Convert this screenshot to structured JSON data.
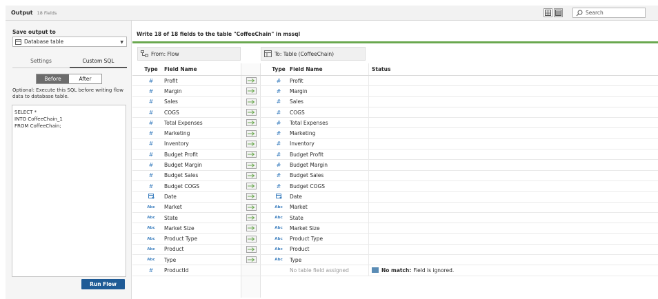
{
  "header": {
    "title": "Output",
    "field_count": "18 Fields",
    "search_placeholder": "Search"
  },
  "left": {
    "save_label": "Save output to",
    "save_target": "Database table",
    "tabs": [
      "Settings",
      "Custom SQL"
    ],
    "segments": [
      "Before",
      "After"
    ],
    "hint": "Optional: Execute this SQL before writing flow data to database table.",
    "sql_lines": [
      "SELECT *",
      "INTO CoffeeChain_1",
      "FROM CoffeeChain;"
    ],
    "run_label": "Run Flow"
  },
  "main": {
    "write_title": "Write 18 of 18 fields to the table \"CoffeeChain\" in mssql",
    "from_label": "From: Flow",
    "to_label": "To: Table (CoffeeChain)",
    "columns": {
      "type": "Type",
      "field_name": "Field Name",
      "status": "Status"
    },
    "rows": [
      {
        "type": "num",
        "from": "Profit",
        "to": "Profit"
      },
      {
        "type": "num",
        "from": "Margin",
        "to": "Margin"
      },
      {
        "type": "num",
        "from": "Sales",
        "to": "Sales"
      },
      {
        "type": "num",
        "from": "COGS",
        "to": "COGS"
      },
      {
        "type": "num",
        "from": "Total Expenses",
        "to": "Total Expenses"
      },
      {
        "type": "num",
        "from": "Marketing",
        "to": "Marketing"
      },
      {
        "type": "num",
        "from": "Inventory",
        "to": "Inventory"
      },
      {
        "type": "num",
        "from": "Budget Profit",
        "to": "Budget Profit"
      },
      {
        "type": "num",
        "from": "Budget Margin",
        "to": "Budget Margin"
      },
      {
        "type": "num",
        "from": "Budget Sales",
        "to": "Budget Sales"
      },
      {
        "type": "num",
        "from": "Budget COGS",
        "to": "Budget COGS"
      },
      {
        "type": "date",
        "from": "Date",
        "to": "Date"
      },
      {
        "type": "abc",
        "from": "Market",
        "to": "Market"
      },
      {
        "type": "abc",
        "from": "State",
        "to": "State"
      },
      {
        "type": "abc",
        "from": "Market Size",
        "to": "Market Size"
      },
      {
        "type": "abc",
        "from": "Product Type",
        "to": "Product Type"
      },
      {
        "type": "abc",
        "from": "Product",
        "to": "Product"
      },
      {
        "type": "abc",
        "from": "Type",
        "to": "Type"
      },
      {
        "type": "num",
        "from": "ProductId",
        "to": "No table field assigned",
        "unassigned": true,
        "status_bold": "No match:",
        "status_text": "Field is ignored."
      }
    ]
  },
  "colors": {
    "accent": "#6aa84f",
    "button": "#1f5b96",
    "type_icon": "#3c7fbf"
  }
}
